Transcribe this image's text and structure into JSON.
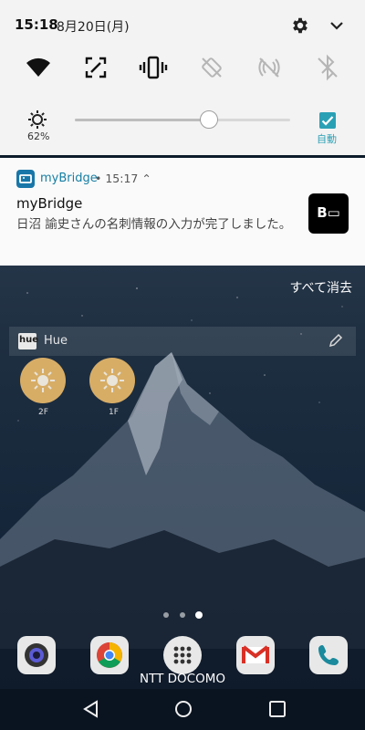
{
  "status": {
    "time": "15:18",
    "date": "8月20日(月)"
  },
  "quick_settings": {
    "tiles": [
      {
        "icon": "wifi-icon",
        "active": true
      },
      {
        "icon": "screen-capture-icon",
        "active": true
      },
      {
        "icon": "vibrate-icon",
        "active": true
      },
      {
        "icon": "auto-rotate-off-icon",
        "active": false
      },
      {
        "icon": "nfc-off-icon",
        "active": false
      },
      {
        "icon": "bluetooth-off-icon",
        "active": false
      }
    ],
    "brightness": {
      "percent_label": "62%",
      "level": 0.62
    },
    "auto_label": "自動"
  },
  "notification": {
    "app": "myBridge",
    "meta": "• 15:17 ⌃",
    "title": "myBridge",
    "text": "日沼 諭史さんの名刺情報の入力が完了しました。",
    "thumb_text": "B▭"
  },
  "home": {
    "clear_all": "すべて消去",
    "widget": {
      "app_name": "Hue",
      "logo_text": "hue",
      "lamps": [
        {
          "label": "2F"
        },
        {
          "label": "1F"
        }
      ]
    },
    "carrier": "NTT DOCOMO"
  },
  "colors": {
    "accent": "#2aa0b5",
    "app_blue": "#167ea3",
    "lamp": "#e7b86a"
  }
}
